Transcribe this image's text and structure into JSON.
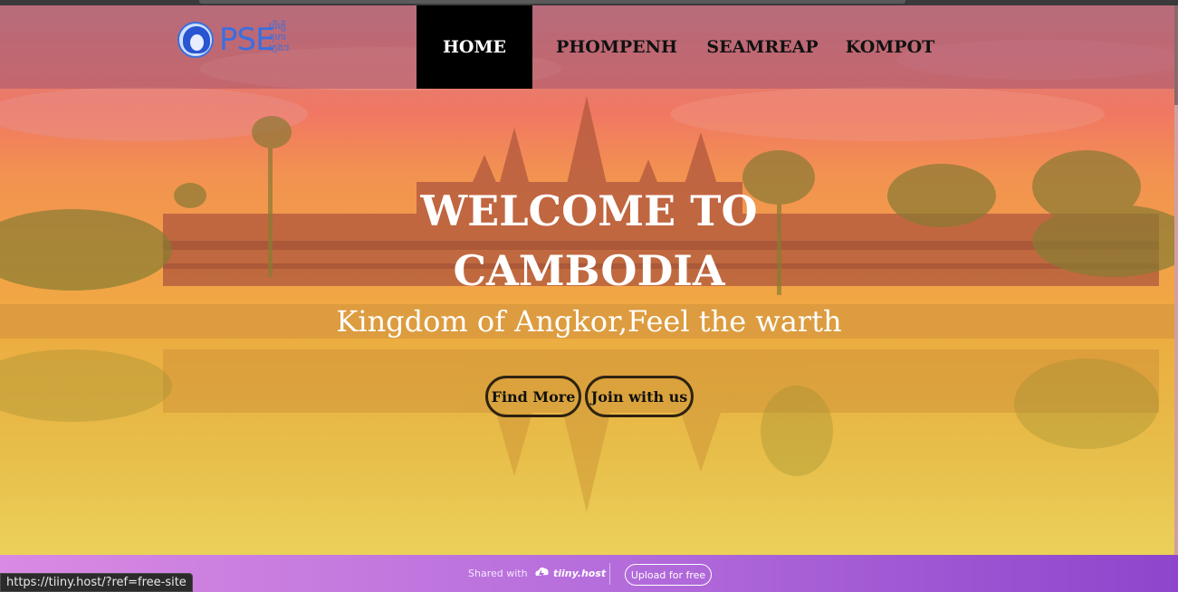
{
  "nav": {
    "logo_text": "PSE",
    "logo_subtext": "ដើម្បីកុមារ ក្មេងៗ",
    "items": [
      {
        "label": "HOME",
        "active": true
      },
      {
        "label": "PHOMPENH",
        "active": false
      },
      {
        "label": "SEAMREAP",
        "active": false
      },
      {
        "label": "KOMPOT",
        "active": false
      }
    ]
  },
  "hero": {
    "title_line1": "WELCOME TO",
    "title_line2": "CAMBODIA",
    "subtitle": "Kingdom of Angkor,Feel the warth",
    "buttons": {
      "find_more": "Find More",
      "join": "Join with us"
    },
    "image_subject": "angkor-wat-temple-reflection"
  },
  "footer": {
    "shared_with": "Shared with",
    "brand": "tiiny.host",
    "upload_button": "Upload for free"
  },
  "status_bar": {
    "url": "https://tiiny.host/?ref=free-site"
  },
  "colors": {
    "nav_active_bg": "#000000",
    "logo_blue": "#3a6fe0",
    "footer_gradient_start": "#d98ae2",
    "footer_gradient_end": "#8e45cc"
  }
}
